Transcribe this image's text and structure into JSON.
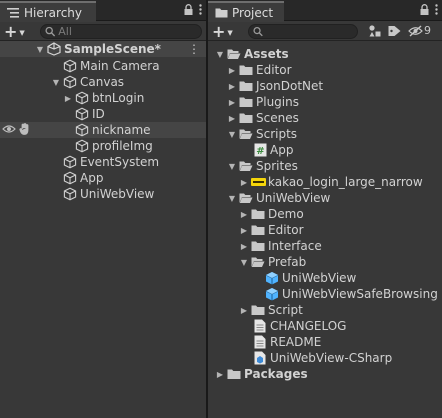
{
  "hierarchy": {
    "tab_label": "Hierarchy",
    "search_placeholder": "All",
    "scene_name": "SampleScene*",
    "items": [
      {
        "label": "Main Camera"
      },
      {
        "label": "Canvas"
      },
      {
        "label": "btnLogin"
      },
      {
        "label": "ID"
      },
      {
        "label": "nickname"
      },
      {
        "label": "profileImg"
      },
      {
        "label": "EventSystem"
      },
      {
        "label": "App"
      },
      {
        "label": "UniWebView"
      }
    ]
  },
  "project": {
    "tab_label": "Project",
    "hidden_count": "9",
    "items": [
      {
        "label": "Assets"
      },
      {
        "label": "Editor"
      },
      {
        "label": "JsonDotNet"
      },
      {
        "label": "Plugins"
      },
      {
        "label": "Scenes"
      },
      {
        "label": "Scripts"
      },
      {
        "label": "App"
      },
      {
        "label": "Sprites"
      },
      {
        "label": "kakao_login_large_narrow"
      },
      {
        "label": "UniWebView"
      },
      {
        "label": "Demo"
      },
      {
        "label": "Editor"
      },
      {
        "label": "Interface"
      },
      {
        "label": "Prefab"
      },
      {
        "label": "UniWebView"
      },
      {
        "label": "UniWebViewSafeBrowsing"
      },
      {
        "label": "Script"
      },
      {
        "label": "CHANGELOG"
      },
      {
        "label": "README"
      },
      {
        "label": "UniWebView-CSharp"
      },
      {
        "label": "Packages"
      }
    ]
  },
  "icons": {
    "gameobject": "cube-outline-icon",
    "folder": "folder-icon",
    "open_folder": "folder-open-icon",
    "script": "csharp-script-icon",
    "sprite": "sprite-icon",
    "prefab": "prefab-cube-icon",
    "document": "text-document-icon",
    "asmdef": "assembly-definition-icon",
    "scene": "unity-scene-icon"
  },
  "colors": {
    "panel": "#383838",
    "tabstrip": "#282828",
    "selection": "#454545",
    "prefab": "#4fb3ff",
    "script_green": "#7bc47f"
  }
}
